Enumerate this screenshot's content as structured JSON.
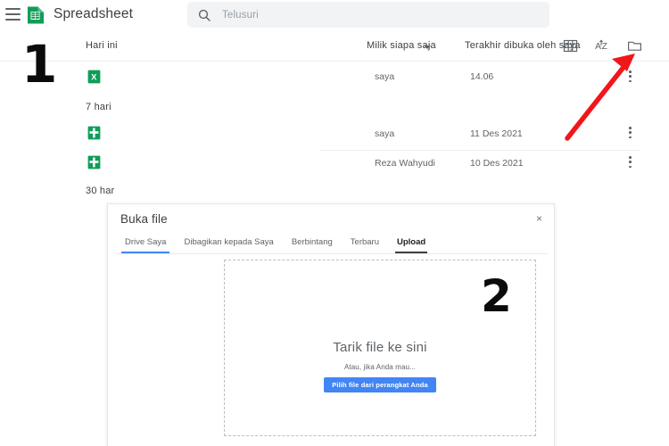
{
  "topbar": {
    "menu_icon": "hamburger-menu-icon",
    "logo_icon": "google-sheets-logo-icon",
    "app_title": "Spreadsheet",
    "search_icon": "search-icon",
    "search_placeholder": "Telusuri",
    "search_value": ""
  },
  "toolbar": {
    "today_label": "Hari ini",
    "owner_filter": "Milik siapa saja",
    "owner_caret_icon": "chevron-down-icon",
    "last_opened_filter": "Terakhir dibuka oleh saya",
    "icons": [
      {
        "name": "grid-view-icon",
        "label": "Tampilan kisi"
      },
      {
        "name": "sort-az-icon",
        "label": "Urutkan A-Z"
      },
      {
        "name": "folder-icon",
        "label": "Buka pemilih file"
      }
    ]
  },
  "filelist": {
    "groups": [
      {
        "label": "7 hari"
      },
      {
        "label": "30 har"
      }
    ],
    "rows": [
      {
        "icon": "xlsx-file-icon",
        "icon_letter": "X",
        "icon_type": "excel",
        "owner": "saya",
        "date": "14.06",
        "more_icon": "more-vertical-icon"
      },
      {
        "icon": "sheets-file-icon",
        "icon_letter": "",
        "icon_type": "sheets",
        "owner": "saya",
        "date": "11 Des 2021",
        "more_icon": "more-vertical-icon"
      },
      {
        "icon": "sheets-file-icon",
        "icon_letter": "",
        "icon_type": "sheets",
        "owner": "Reza Wahyudi",
        "date": "10 Des 2021",
        "more_icon": "more-vertical-icon"
      }
    ]
  },
  "annotations": {
    "step_one": "1",
    "step_two": "2",
    "arrow_color": "#f1161a",
    "arrow_icon": "red-arrow-pointing-to-folder-icon"
  },
  "dialog": {
    "title": "Buka file",
    "close_icon": "close-icon",
    "close_label": "×",
    "tabs": [
      {
        "label": "Drive Saya",
        "state": "underlined"
      },
      {
        "label": "Dibagikan kepada Saya",
        "state": "default"
      },
      {
        "label": "Berbintang",
        "state": "default"
      },
      {
        "label": "Terbaru",
        "state": "default"
      },
      {
        "label": "Upload",
        "state": "active"
      }
    ],
    "dropzone": {
      "main_text": "Tarik file ke sini",
      "sub_text": "Atau, jika Anda mau...",
      "button_label": "Pilih file dari perangkat Anda",
      "button_color": "#4285f4"
    }
  },
  "colors": {
    "sheets_green": "#0f9d58",
    "accent_blue": "#4285f4",
    "text_primary": "#3c4043",
    "text_secondary": "#5f6368",
    "search_bg": "#f1f3f4"
  }
}
